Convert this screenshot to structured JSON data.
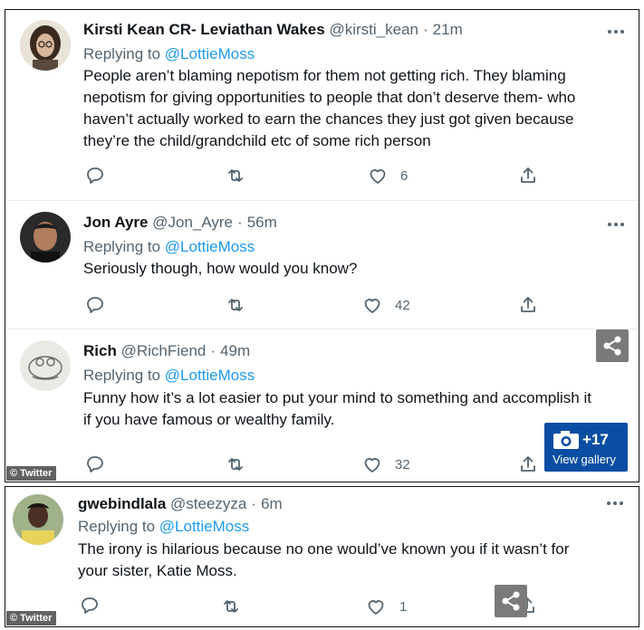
{
  "tweets": [
    {
      "name": "Kirsti Kean CR- Leviathan Wakes",
      "handle": "@kirsti_kean",
      "time": "21m",
      "replying_prefix": "Replying to",
      "replying_handle": "@LottieMoss",
      "body": [
        "People aren’t blaming nepotism for them not getting rich. They blaming",
        "nepotism for giving opportunities to people that don’t deserve them- who",
        "haven’t actually worked to earn the chances they just got given because",
        "they’re the child/grandchild etc of some rich person"
      ],
      "likes": "6"
    },
    {
      "name": "Jon Ayre",
      "handle": "@Jon_Ayre",
      "time": "56m",
      "replying_prefix": "Replying to",
      "replying_handle": "@LottieMoss",
      "body": [
        "Seriously though, how would you know?"
      ],
      "likes": "42"
    },
    {
      "name": "Rich",
      "handle": "@RichFiend",
      "time": "49m",
      "replying_prefix": "Replying to",
      "replying_handle": "@LottieMoss",
      "body": [
        "Funny how it’s a lot easier to put your mind to something and accomplish it",
        "if you have famous or wealthy family."
      ],
      "likes": "32"
    },
    {
      "name": "gwebindlala",
      "handle": "@steezyza",
      "time": "6m",
      "replying_prefix": "Replying to",
      "replying_handle": "@LottieMoss",
      "body": [
        "The irony is hilarious because no one would’ve known you if it wasn’t for",
        "your sister, Katie Moss."
      ],
      "likes": "1"
    }
  ],
  "watermark": "© Twitter",
  "gallery": {
    "count": "+17",
    "label": "View gallery"
  },
  "icons": [
    "reply-icon",
    "retweet-icon",
    "like-icon",
    "share-icon",
    "more-icon",
    "camera-icon",
    "share-network-icon"
  ],
  "colors": {
    "mention": "#1d9bf0",
    "muted": "#536471",
    "text": "#0f1419",
    "gallery_bg": "#0a4ea3"
  }
}
